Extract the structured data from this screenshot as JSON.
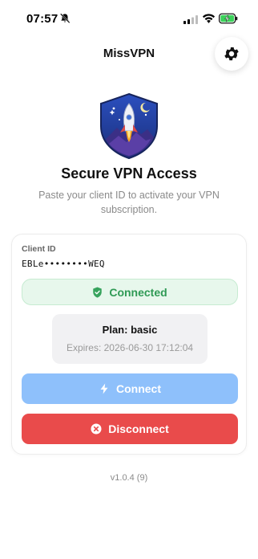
{
  "status_bar": {
    "time": "07:57",
    "icons": [
      "bell-slash-icon",
      "cellular-signal-icon",
      "wifi-icon",
      "battery-charging-icon"
    ]
  },
  "header": {
    "title": "MissVPN",
    "settings_icon": "gear-icon"
  },
  "hero": {
    "logo_icon": "rocket-shield-icon",
    "headline": "Secure VPN Access",
    "subtitle": "Paste your client ID to activate your VPN subscription."
  },
  "card": {
    "client_id_label": "Client ID",
    "client_id_value": "EBLe••••••••WEQ",
    "status": {
      "text": "Connected",
      "icon": "shield-check-icon",
      "color": "#2f9a55"
    },
    "plan": {
      "title": "Plan: basic",
      "expires": "Expires: 2026-06-30 17:12:04"
    },
    "connect_button": {
      "label": "Connect",
      "icon": "lightning-bolt-icon",
      "color": "#8ec0fb"
    },
    "disconnect_button": {
      "label": "Disconnect",
      "icon": "x-circle-icon",
      "color": "#e94b4b"
    }
  },
  "footer": {
    "version": "v1.0.4 (9)"
  }
}
